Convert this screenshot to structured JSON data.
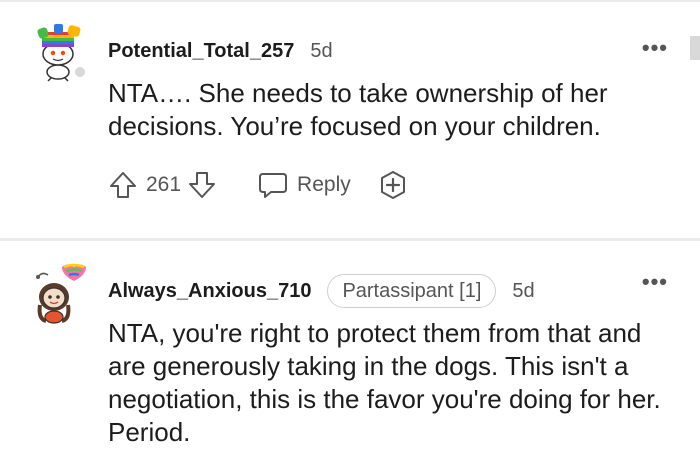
{
  "comments": [
    {
      "username": "Potential_Total_257",
      "age": "5d",
      "text": "NTA…. She needs to take ownership of her decisions. You’re focused on your children.",
      "votes": "261",
      "reply_label": "Reply"
    },
    {
      "username": "Always_Anxious_710",
      "flair": "Partassipant [1]",
      "age": "5d",
      "text": "NTA, you're right to protect them from that and are generously taking in the dogs. This isn't a negotiation, this is the favor you're doing for her. Period."
    }
  ],
  "icons": {
    "more": "more-options-icon",
    "upvote": "upvote-arrow-icon",
    "downvote": "downvote-arrow-icon",
    "reply": "speech-bubble-icon",
    "award": "award-plus-icon"
  },
  "colors": {
    "text": "#1c1c1c",
    "muted": "#555555",
    "divider": "#ececec",
    "flair_border": "#cfcfcf"
  }
}
